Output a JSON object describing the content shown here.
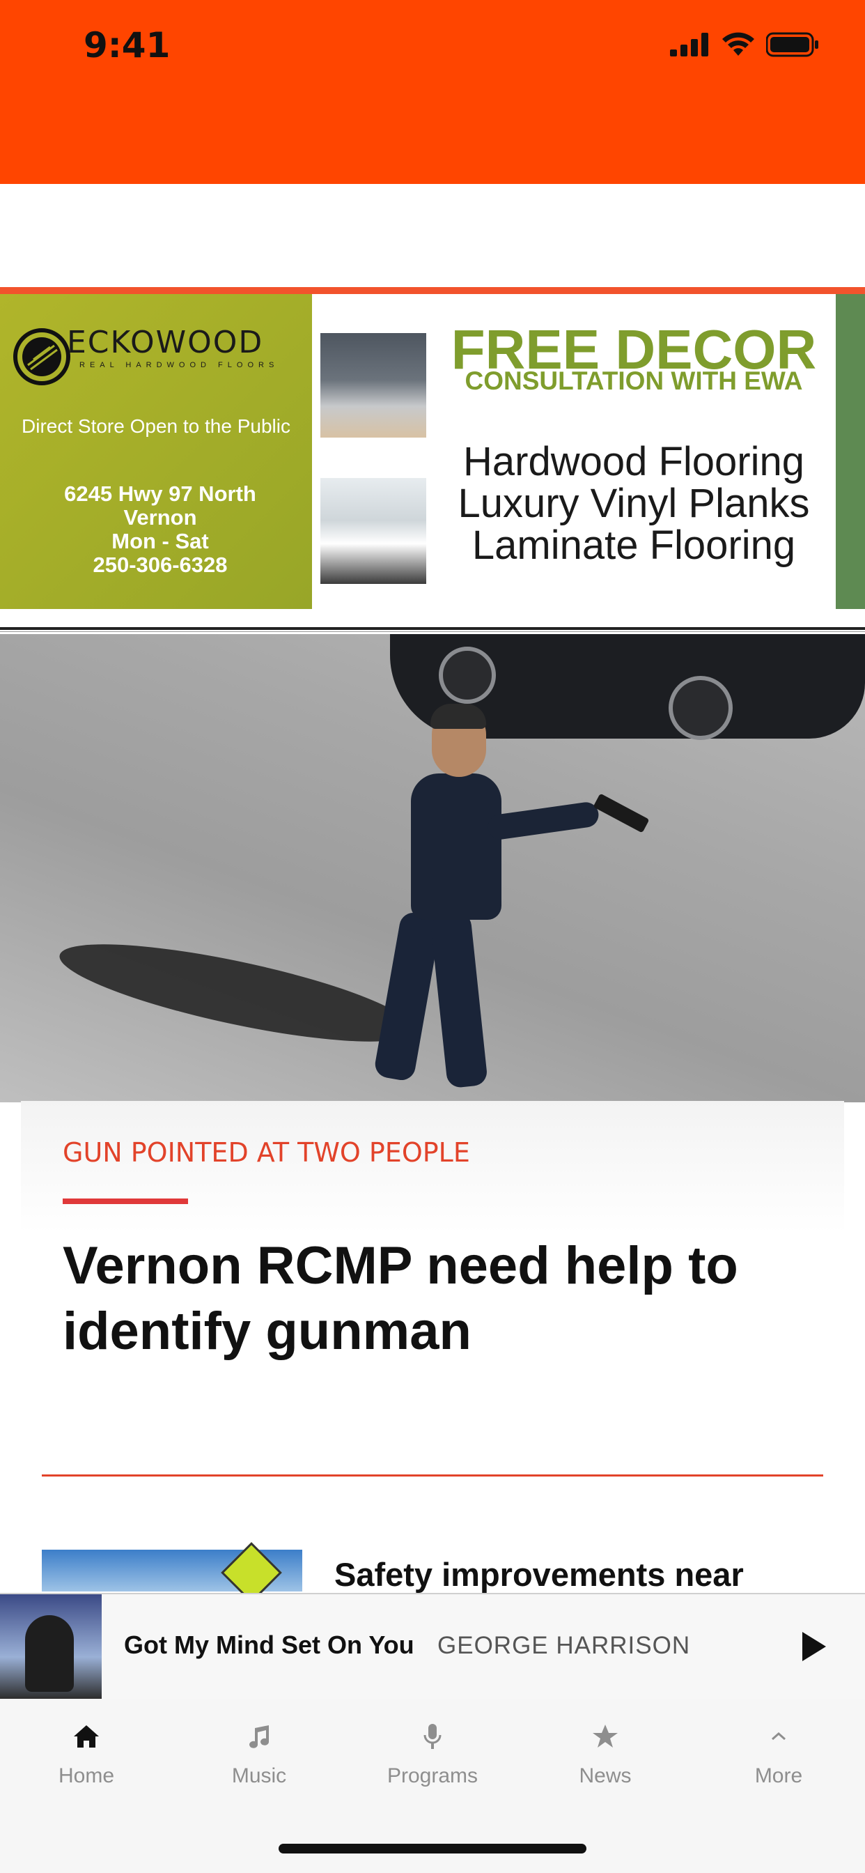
{
  "status_bar": {
    "time": "9:41"
  },
  "ad": {
    "brand": "ECKOWOOD",
    "brand_sub": "REAL HARDWOOD FLOORS",
    "tagline": "Direct Store Open to the Public",
    "address_line1": "6245 Hwy 97 North",
    "address_line2": "Vernon",
    "hours": "Mon - Sat",
    "phone": "250-306-6328",
    "headline": "FREE DECOR",
    "subheadline": "CONSULTATION WITH EWA",
    "products": [
      "Hardwood Flooring",
      "Luxury Vinyl Planks",
      "Laminate Flooring"
    ],
    "colors": {
      "left_panel": "#a8b02a",
      "headline": "#7f9d2d"
    }
  },
  "story": {
    "kicker": "GUN POINTED AT TWO PEOPLE",
    "headline": "Vernon RCMP need help to identify gunman"
  },
  "next_story": {
    "title": "Safety improvements near"
  },
  "player": {
    "song": "Got My Mind Set On You",
    "artist": "GEORGE HARRISON",
    "play_icon": "play-icon"
  },
  "tabs": [
    {
      "label": "Home",
      "icon": "home-icon",
      "active": true
    },
    {
      "label": "Music",
      "icon": "music-note-icon",
      "active": false
    },
    {
      "label": "Programs",
      "icon": "microphone-icon",
      "active": false
    },
    {
      "label": "News",
      "icon": "star-icon",
      "active": false
    },
    {
      "label": "More",
      "icon": "chevron-up-icon",
      "active": false
    }
  ],
  "colors": {
    "accent": "#ff4500",
    "kicker": "#e2432a"
  }
}
